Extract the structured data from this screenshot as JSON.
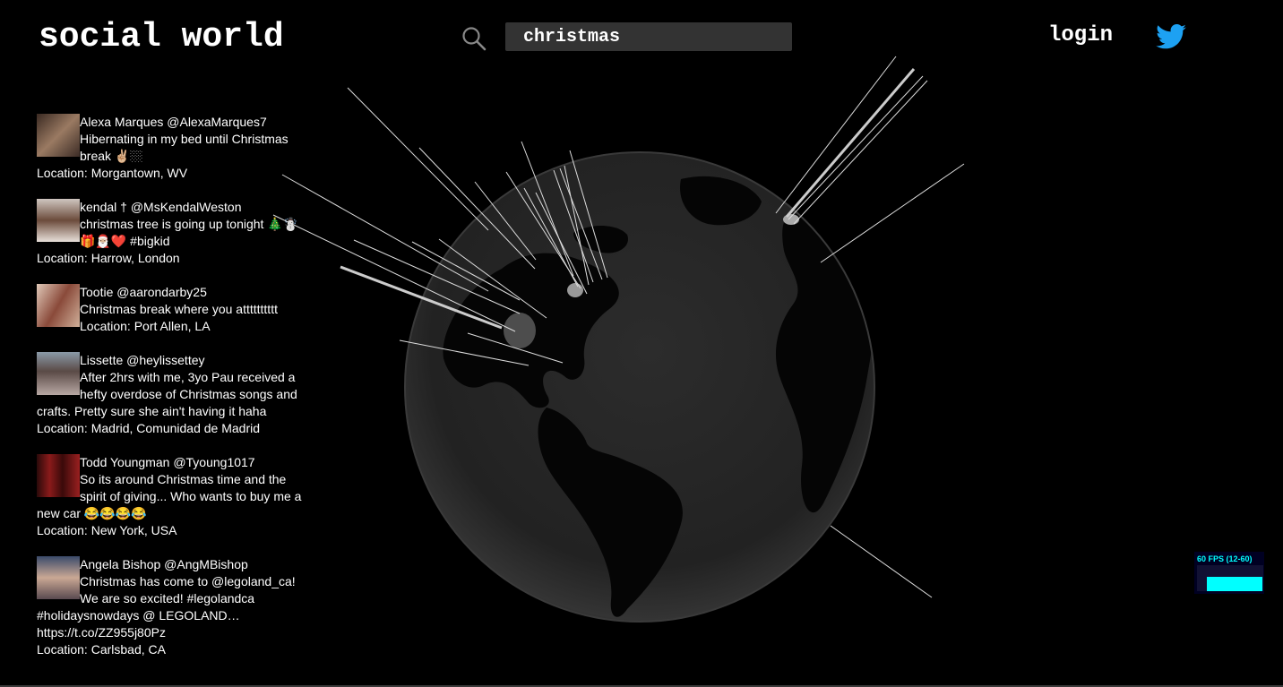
{
  "app": {
    "title": "social world"
  },
  "header": {
    "search_value": "christmas",
    "login_label": "login",
    "icons": {
      "search": "search-icon",
      "twitter": "twitter-bird-icon"
    },
    "twitter_color": "#1da1f2"
  },
  "tweets": [
    {
      "user": "Alexa Marques @AlexaMarques7",
      "text": "Hibernating in my bed until Christmas break ✌🏼🏼",
      "location": "Location: Morgantown, WV",
      "avatar_color": "#7a5a4a"
    },
    {
      "user": "kendal † @MsKendalWeston",
      "text": "christmas tree is going up tonight 🎄☃️🎁🎅🏼❤️ #bigkid",
      "location": "Location: Harrow, London",
      "avatar_color": "#6b4b3b"
    },
    {
      "user": "Tootie @aarondarby25",
      "text": "Christmas break where you atttttttttt",
      "location": "Location: Port Allen, LA",
      "avatar_color": "#8a6a55"
    },
    {
      "user": "Lissette @heylissettey",
      "text": "After 2hrs with me, 3yo Pau received a hefty overdose of Christmas songs and crafts. Pretty sure she ain't having it haha",
      "location": "Location: Madrid, Comunidad de Madrid",
      "avatar_color": "#7d7d86"
    },
    {
      "user": "Todd Youngman @Tyoung1017",
      "text": "So its around Christmas time and the spirit of giving... Who wants to buy me a new car 😂😂😂😂",
      "location": "Location: New York, USA",
      "avatar_color": "#5a1a1a"
    },
    {
      "user": "Angela Bishop @AngMBishop",
      "text": "Christmas has come to @legoland_ca! We are so excited! #legolandca #holidaysnowdays @ LEGOLAND… https://t.co/ZZ955j80Pz",
      "location": "Location: Carlsbad, CA",
      "avatar_color": "#5b6c82"
    }
  ],
  "stats": {
    "fps_label": "60 FPS (12-60)",
    "fps_color": "#00ffff"
  }
}
